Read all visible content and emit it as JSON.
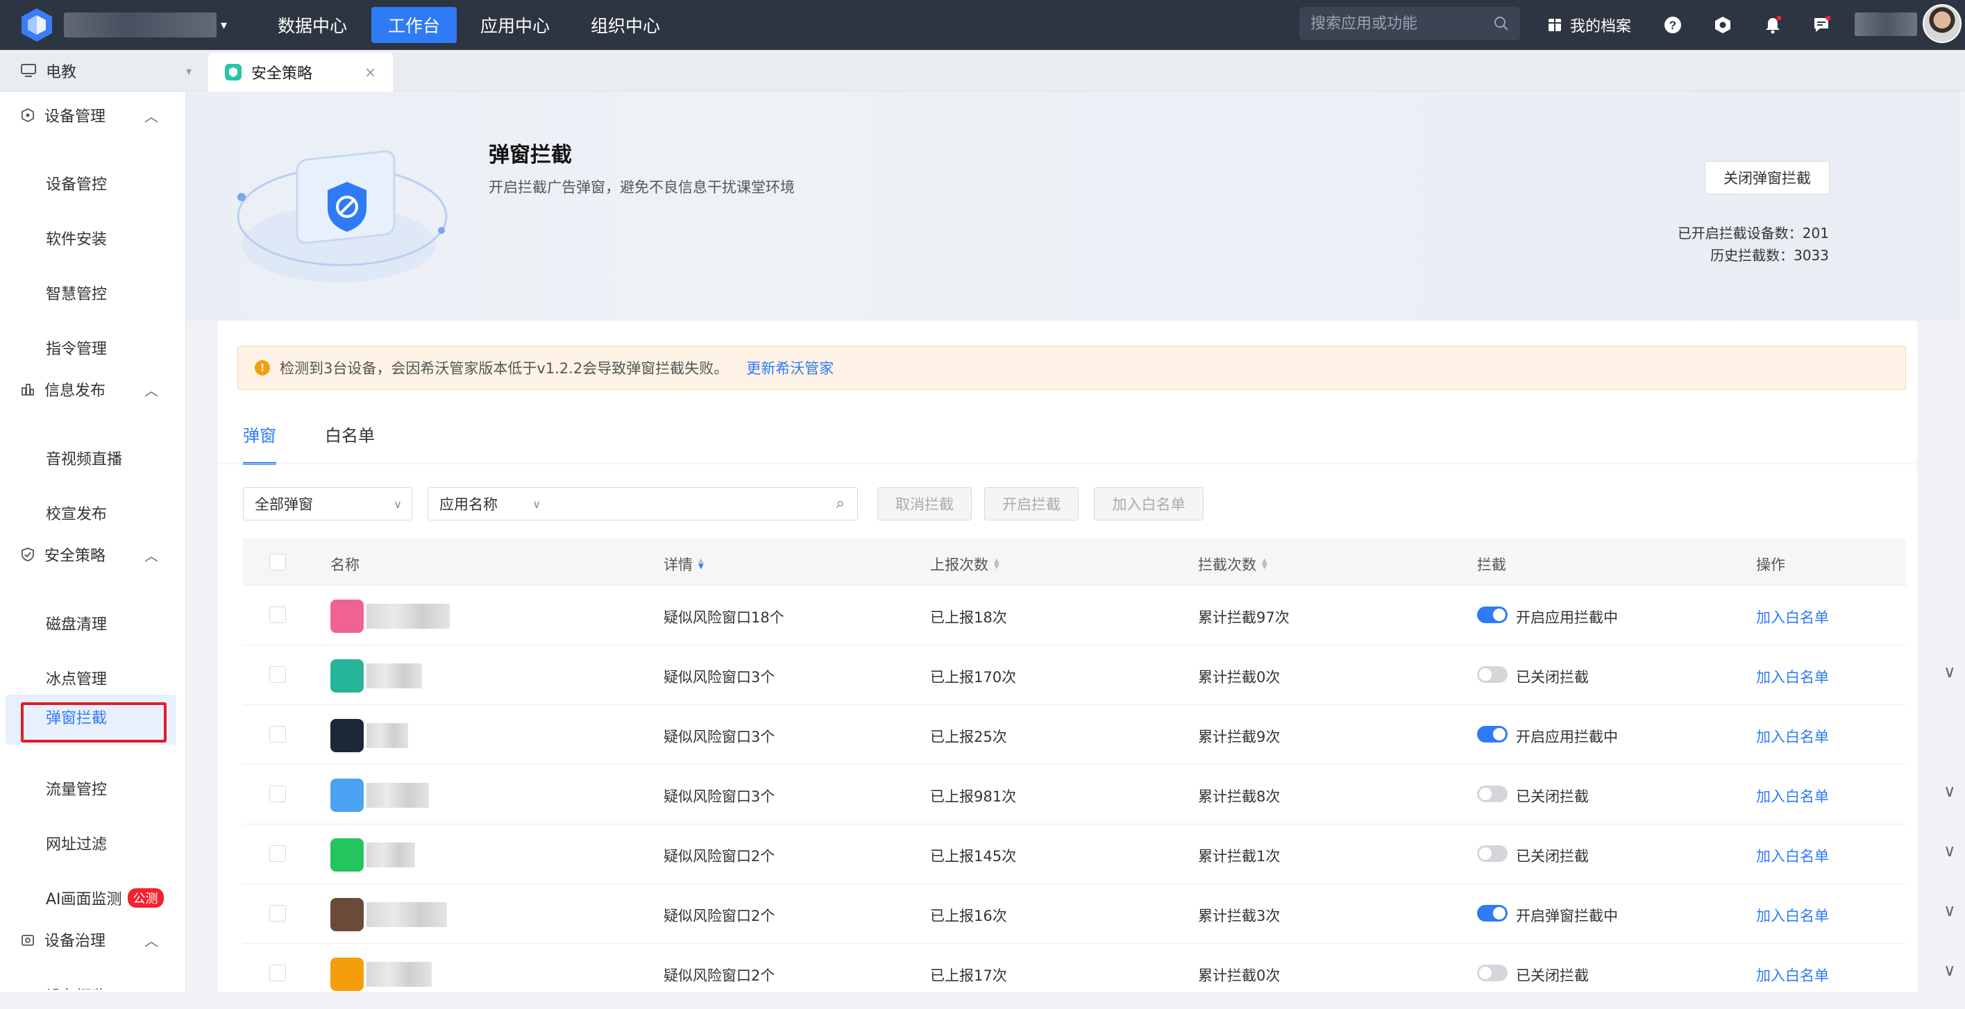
{
  "topbar": {
    "nav": [
      {
        "label": "数据中心",
        "active": false
      },
      {
        "label": "工作台",
        "active": true
      },
      {
        "label": "应用中心",
        "active": false
      },
      {
        "label": "组织中心",
        "active": false
      }
    ],
    "search_placeholder": "搜索应用或功能",
    "archive_label": "我的档案"
  },
  "tabbar": {
    "tree_label": "电教",
    "tab_label": "安全策略"
  },
  "sidebar": {
    "groups": [
      {
        "label": "设备管理",
        "items": [
          "设备管控",
          "软件安装",
          "智慧管控",
          "指令管理"
        ]
      },
      {
        "label": "信息发布",
        "items": [
          "音视频直播",
          "校宣发布"
        ]
      },
      {
        "label": "安全策略",
        "items": [
          "磁盘清理",
          "冰点管理",
          "弹窗拦截",
          "流量管控",
          "网址过滤",
          "AI画面监测"
        ]
      },
      {
        "label": "设备治理",
        "items": [
          "设备概览"
        ]
      }
    ],
    "active_item": "弹窗拦截",
    "badge": "公测"
  },
  "hero": {
    "title": "弹窗拦截",
    "subtitle": "开启拦截广告弹窗，避免不良信息干扰课堂环境",
    "button": "关闭弹窗拦截",
    "stat1": "已开启拦截设备数：201",
    "stat2": "历史拦截数：3033"
  },
  "alert": {
    "text": "检测到3台设备，会因希沃管家版本低于v1.2.2会导致弹窗拦截失败。",
    "link": "更新希沃管家"
  },
  "tabs": [
    "弹窗",
    "白名单"
  ],
  "filters": {
    "type": "全部弹窗",
    "field": "应用名称",
    "search_value": "",
    "btn_cancel": "取消拦截",
    "btn_enable": "开启拦截",
    "btn_whitelist": "加入白名单"
  },
  "columns": [
    "名称",
    "详情",
    "上报次数",
    "拦截次数",
    "拦截",
    "操作"
  ],
  "rows": [
    {
      "name": "",
      "detail": "疑似风险窗口18个",
      "reports": "已上报18次",
      "blocks": "累计拦截97次",
      "status": "开启应用拦截中",
      "on": true,
      "action": "加入白名单",
      "icon_color": "#f06292",
      "expand": false
    },
    {
      "name": "",
      "detail": "疑似风险窗口3个",
      "reports": "已上报170次",
      "blocks": "累计拦截0次",
      "status": "已关闭拦截",
      "on": false,
      "action": "加入白名单",
      "icon_color": "#26b59a",
      "expand": true
    },
    {
      "name": "",
      "detail": "疑似风险窗口3个",
      "reports": "已上报25次",
      "blocks": "累计拦截9次",
      "status": "开启应用拦截中",
      "on": true,
      "action": "加入白名单",
      "icon_color": "#1b2838",
      "expand": false
    },
    {
      "name": "",
      "detail": "疑似风险窗口3个",
      "reports": "已上报981次",
      "blocks": "累计拦截8次",
      "status": "已关闭拦截",
      "on": false,
      "action": "加入白名单",
      "icon_color": "#4aa3f0",
      "expand": true
    },
    {
      "name": "",
      "detail": "疑似风险窗口2个",
      "reports": "已上报145次",
      "blocks": "累计拦截1次",
      "status": "已关闭拦截",
      "on": false,
      "action": "加入白名单",
      "icon_color": "#22c55e",
      "expand": true
    },
    {
      "name": "",
      "detail": "疑似风险窗口2个",
      "reports": "已上报16次",
      "blocks": "累计拦截3次",
      "status": "开启弹窗拦截中",
      "on": true,
      "action": "加入白名单",
      "icon_color": "#6b4a3a",
      "expand": true
    },
    {
      "name": "",
      "detail": "疑似风险窗口2个",
      "reports": "已上报17次",
      "blocks": "累计拦截0次",
      "status": "已关闭拦截",
      "on": false,
      "action": "加入白名单",
      "icon_color": "#f59e0b",
      "expand": true
    }
  ],
  "colors": {
    "accent": "#2f7bf5",
    "topbar": "#2d3542",
    "alert_bg": "#fef3e6",
    "badge": "#f5222d"
  }
}
